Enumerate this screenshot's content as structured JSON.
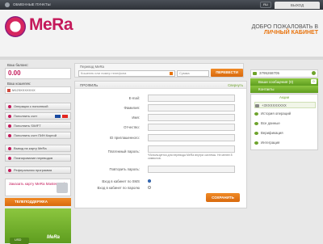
{
  "topbar": {
    "exchange_points": "ОБМЕННЫЕ ПУНКТЫ",
    "language": "RU",
    "exit": "ВЫХОД"
  },
  "header": {
    "logo": "MeRa",
    "welcome_line1": "ДОБРО ПОЖАЛОВАТЬ В",
    "welcome_line2": "ЛИЧНЫЙ КАБИНЕТ"
  },
  "left": {
    "balance_label": "Ваш баланс:",
    "balance_value": "0.00",
    "wallet_label": "Ваш кошелек:",
    "wallet_value": "M123XXXXXXX",
    "menu": [
      "Операции с пополнкой",
      "Пополнить счет",
      "Пополнить SWIFT",
      "Пополнить счет ПИН Картой",
      "Вывод на карту MeRa",
      "Планирование переводов",
      "Реферальная программа"
    ],
    "mc_banner": "Заказать карту MeRa MasterCard",
    "orange_bar": "ТЕЛЕПОДДЕРЖКА",
    "currency": "USD",
    "mini_logo": "MeRa",
    "btn_withdraw": "Выплата",
    "btn_mera": "MeRa"
  },
  "transfer": {
    "label": "Перевод MeRa",
    "recipient_placeholder": "Кошелек или номер телефона",
    "amount_placeholder": "Сумма",
    "button": "ПЕРЕВЕСТИ"
  },
  "profile": {
    "title": "ПРОФИЛЬ",
    "collapse": "Свернуть",
    "fields": [
      "E-mail:",
      "Фамилия:",
      "Имя:",
      "Отчество:",
      "ID приглашенного:",
      "Платежный пароль:",
      "Повторить пароль:"
    ],
    "password_hint": "*Используется для перевода MeRa внутри системы. Не менее 8 символов.",
    "sms_label": "Вход в кабинет по SMS",
    "pass_label": "Вход в кабинет по паролю",
    "save": "СОХРАНИТЬ"
  },
  "right": {
    "phone": "3795268705",
    "messages": "Ваши сообщения (0)",
    "messages_count": "0",
    "contacts": "Контакты",
    "list_title": "Акции",
    "items": [
      "+3XXXXXXXXX",
      "История операций",
      "Все данные",
      "Верификация",
      "Интеграция"
    ]
  }
}
